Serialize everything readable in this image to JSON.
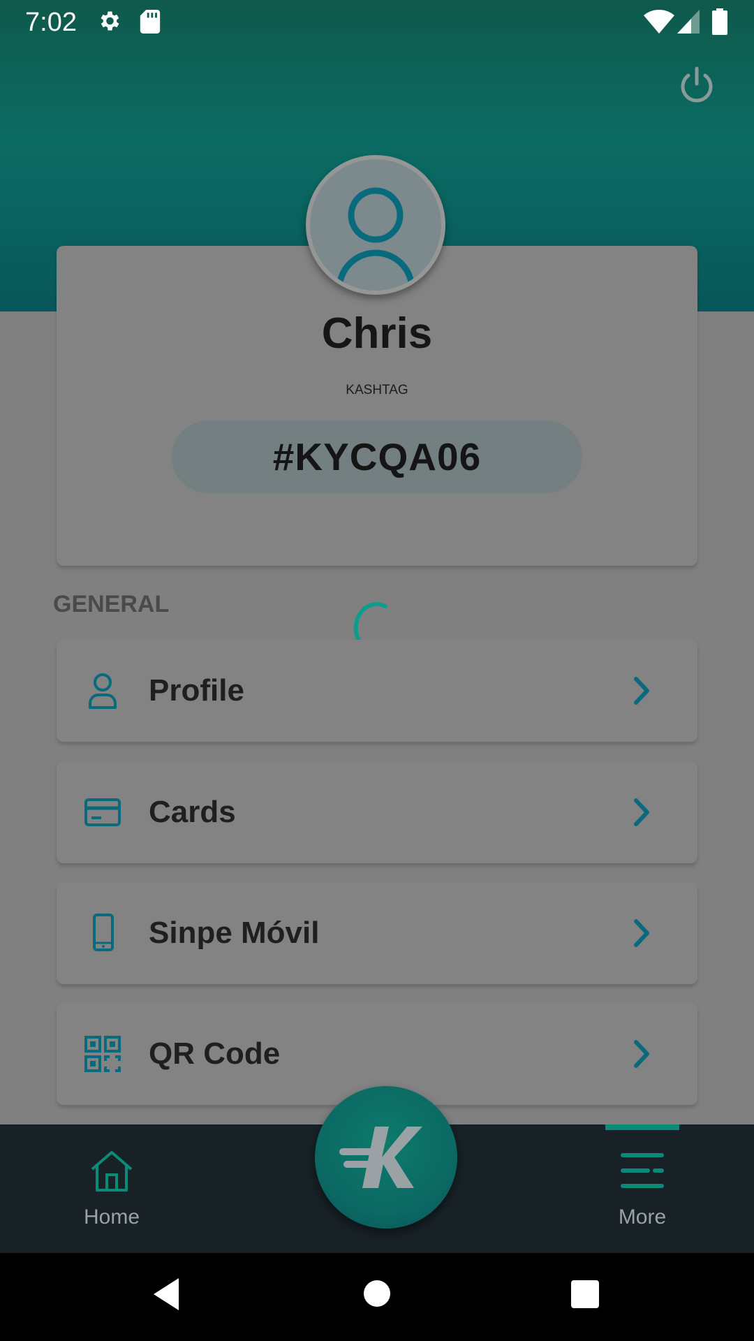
{
  "status_bar": {
    "time": "7:02"
  },
  "profile": {
    "name": "Chris",
    "kashtag_label": "KASHTAG",
    "kashtag": "#KYCQA06"
  },
  "section": {
    "title": "GENERAL"
  },
  "menu": {
    "items": [
      {
        "label": "Profile",
        "icon": "person-icon"
      },
      {
        "label": "Cards",
        "icon": "card-icon"
      },
      {
        "label": "Sinpe Móvil",
        "icon": "phone-icon"
      },
      {
        "label": "QR Code",
        "icon": "qr-code-icon"
      }
    ]
  },
  "bottom_nav": {
    "home_label": "Home",
    "more_label": "More",
    "active": "More"
  },
  "colors": {
    "accent": "#0b8a78",
    "icon_blue": "#086a7c",
    "header_top": "#0f594b",
    "nav_bg": "#172126"
  }
}
